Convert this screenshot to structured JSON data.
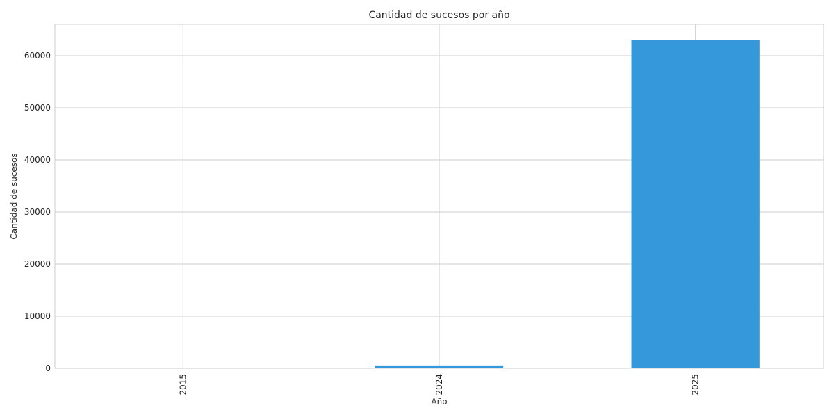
{
  "chart_data": {
    "type": "bar",
    "title": "Cantidad de sucesos por año",
    "xlabel": "Año",
    "ylabel": "Cantidad de sucesos",
    "categories": [
      "2015",
      "2024",
      "2025"
    ],
    "values": [
      1,
      550,
      62950
    ],
    "ylim": [
      0,
      66000
    ],
    "yticks": [
      0,
      10000,
      20000,
      30000,
      40000,
      50000,
      60000
    ],
    "grid": true,
    "bar_color": "#3498db",
    "grid_color": "#cccccc",
    "frame_color": "#cccccc"
  }
}
